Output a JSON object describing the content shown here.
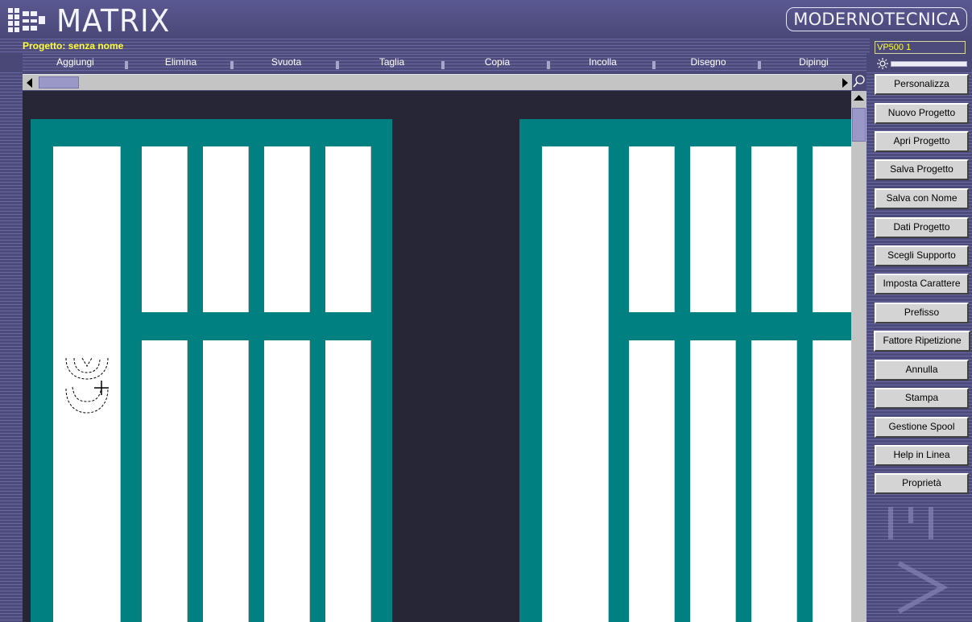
{
  "app": {
    "title": "MATRIX",
    "brand": "MODERNOTECNICA",
    "project_label": "Progetto: senza nome",
    "device": "VP500 1"
  },
  "menu": [
    "Aggiungi",
    "Elimina",
    "Svuota",
    "Taglia",
    "Copia",
    "Incolla",
    "Disegno",
    "Dipingi"
  ],
  "sidebar_buttons": [
    "Personalizza",
    "Nuovo Progetto",
    "Apri Progetto",
    "Salva Progetto",
    "Salva con Nome",
    "Dati Progetto",
    "Scegli Supporto",
    "Imposta Carattere",
    "Prefisso",
    "Fattore Ripetizione",
    "Annulla",
    "Stampa",
    "Gestione Spool",
    "Help in Linea",
    "Proprietà"
  ],
  "icons": {
    "logo": "matrix-logo-icon",
    "brightness": "sun-icon",
    "zoom": "magnifier-icon",
    "cursor": "stamp-cursor-icon"
  },
  "colors": {
    "background": "#4d4b7c",
    "canvas": "#272637",
    "panel": "#008080",
    "project_label": "#ffff33"
  }
}
